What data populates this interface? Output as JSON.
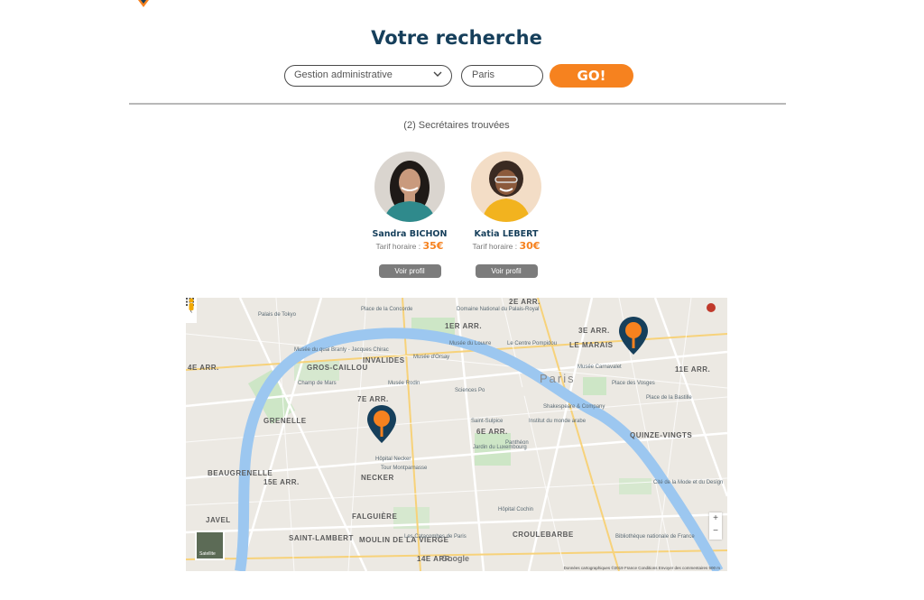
{
  "header": {
    "title": "Votre recherche"
  },
  "search": {
    "category": "Gestion administrative",
    "city": "Paris",
    "submit_label": "GO!"
  },
  "results": {
    "count_text": "(2) Secrétaires trouvées",
    "items": [
      {
        "name": "Sandra BICHON",
        "rate_label": "Tarif horaire :",
        "price": "35€",
        "profile_label": "Voir profil"
      },
      {
        "name": "Katia LEBERT",
        "rate_label": "Tarif horaire :",
        "price": "30€",
        "profile_label": "Voir profil"
      }
    ]
  },
  "map": {
    "districts": [
      "2E ARR.",
      "1ER ARR.",
      "3E ARR.",
      "LE MARAIS",
      "INVALIDES",
      "GROS-CAILLOU",
      "7E ARR.",
      "6E ARR.",
      "GRENELLE",
      "15E ARR.",
      "NECKER",
      "BEAUGRENELLE",
      "JAVEL",
      "SAINT-LAMBERT",
      "MOULIN DE LA VIERGE",
      "FALGUIÈRE",
      "CROULEBARBE",
      "14E ARR.",
      "11E ARR.",
      "QUINZE-VINGTS",
      "4E ARR."
    ],
    "city_label": "Paris",
    "places": [
      "Palais de Tokyo",
      "Place de la Concorde",
      "Domaine National du Palais-Royal",
      "Le Centre Pompidou",
      "Musée du Louvre",
      "Musée d'Orsay",
      "Musée Rodin",
      "Musée Carnavalet",
      "Place des Vosges",
      "Place de la Bastille",
      "Jardin du Luxembourg",
      "Panthéon",
      "Tour Montparnasse",
      "Hôpital Necker",
      "Les Catacombes de Paris",
      "Champ de Mars",
      "Cité de la Mode et du Design",
      "Institut du monde arabe",
      "Shakespeare & Company",
      "Sciences Po",
      "Hôpital Cochin",
      "Le Jardin du Luxembourg",
      "Musée du quai Branly - Jacques Chirac",
      "Bibliothèque nationale de France",
      "Saint-Sulpice",
      "Le Centre Pompidou"
    ],
    "satellite_label": "Satellite",
    "google_label": "Google",
    "attribution": "Données cartographiques ©2019   France   Conditions   Envoyer des commentaires   500 m",
    "zoom_in": "+",
    "zoom_out": "−",
    "accent": "#f6821f",
    "marker_color": "#163f5b"
  },
  "colors": {
    "brand": "#163f5b",
    "accent": "#f6821f",
    "button_gray": "#7c7c7c"
  }
}
